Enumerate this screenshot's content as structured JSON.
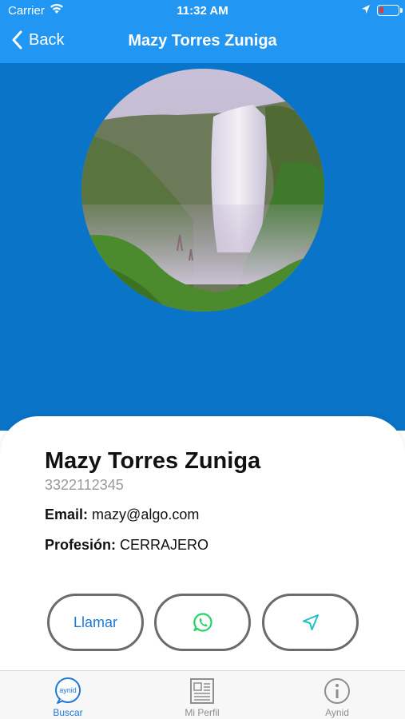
{
  "status": {
    "carrier": "Carrier",
    "time": "11:32 AM",
    "battery_color": "#e53935"
  },
  "nav": {
    "back_label": "Back",
    "title": "Mazy Torres Zuniga"
  },
  "colors": {
    "nav_bg": "#2196f3",
    "hero_bg": "#0a74c9",
    "accent": "#1e78d6",
    "whatsapp": "#25d366",
    "direction": "#1ec1c8"
  },
  "profile": {
    "name": "Mazy Torres Zuniga",
    "phone": "3322112345",
    "email_label": "Email:",
    "email": "mazy@algo.com",
    "profession_label": "Profesión:",
    "profession": "CERRAJERO"
  },
  "actions": {
    "call_label": "Llamar",
    "whatsapp_icon": "whatsapp-icon",
    "direction_icon": "location-arrow-icon"
  },
  "tabs": [
    {
      "label": "Buscar",
      "icon": "aynid-logo-icon",
      "icon_text": "aynid",
      "selected": true
    },
    {
      "label": "Mi Perfil",
      "icon": "profile-card-icon",
      "selected": false
    },
    {
      "label": "Aynid",
      "icon": "info-icon",
      "selected": false
    }
  ]
}
